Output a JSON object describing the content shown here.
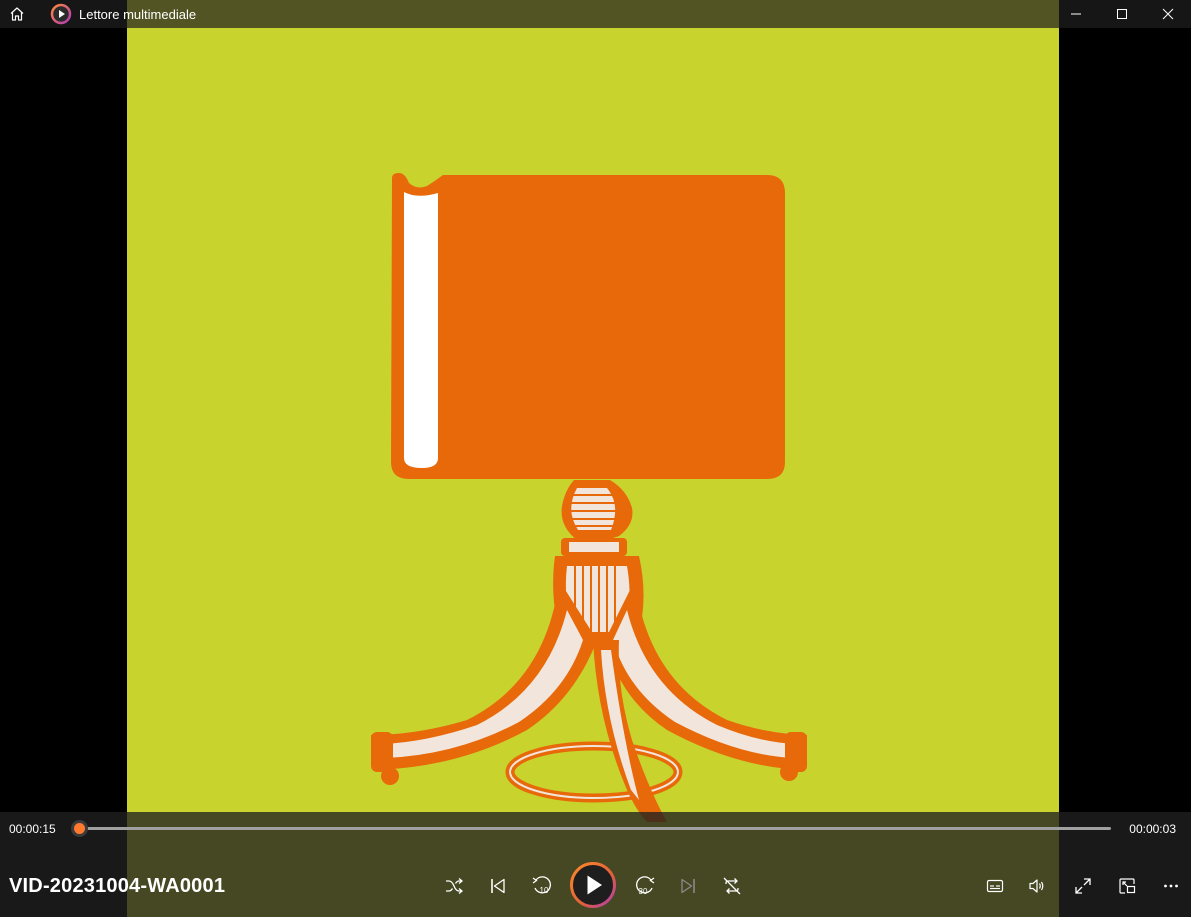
{
  "window": {
    "title": "Lettore multimediale"
  },
  "playback": {
    "current_time": "00:00:15",
    "remaining_time": "00:00:03",
    "progress": 0.0
  },
  "media": {
    "title": "VID-20231004-WA0001"
  },
  "controls": {
    "shuffle_icon": "shuffle-icon",
    "previous_icon": "previous-track-icon",
    "rewind_icon": "rewind-10-icon",
    "rewind_label": "10",
    "play_icon": "play-icon",
    "forward_icon": "forward-30-icon",
    "forward_label": "30",
    "next_icon": "next-track-icon",
    "repeat_icon": "repeat-off-icon",
    "captions_icon": "captions-icon",
    "volume_icon": "volume-icon",
    "fullscreen_icon": "fullscreen-icon",
    "miniplayer_icon": "miniplayer-icon",
    "more_icon": "more-icon"
  },
  "colors": {
    "video_background": "#c8d42d",
    "artwork_orange": "#e8690a",
    "accent": "#ff7a2f",
    "accent_gradient_end": "#b03ab8"
  }
}
